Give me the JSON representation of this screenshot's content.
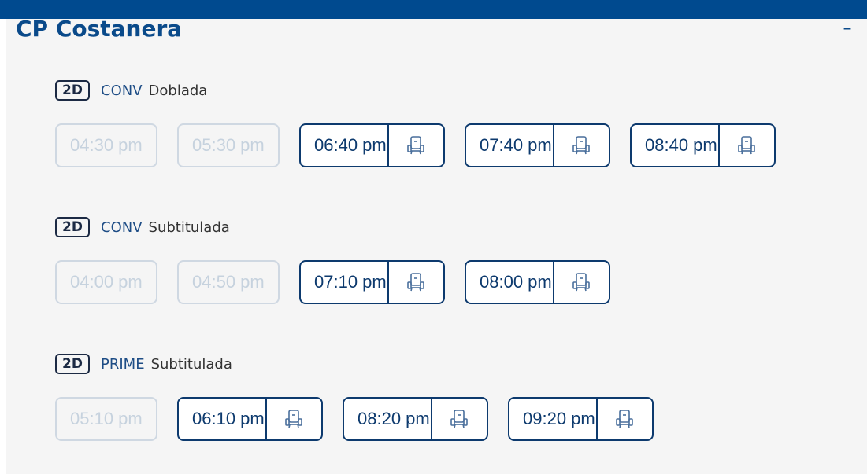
{
  "cinema": {
    "name": "CP Costanera",
    "collapse_symbol": "–"
  },
  "groups": [
    {
      "badge": "2D",
      "type": "CONV",
      "language": "Doblada",
      "times": [
        {
          "label": "04:30 pm",
          "available": false
        },
        {
          "label": "05:30 pm",
          "available": false
        },
        {
          "label": "06:40 pm",
          "available": true
        },
        {
          "label": "07:40 pm",
          "available": true
        },
        {
          "label": "08:40 pm",
          "available": true
        }
      ]
    },
    {
      "badge": "2D",
      "type": "CONV",
      "language": "Subtitulada",
      "times": [
        {
          "label": "04:00 pm",
          "available": false
        },
        {
          "label": "04:50 pm",
          "available": false
        },
        {
          "label": "07:10 pm",
          "available": true
        },
        {
          "label": "08:00 pm",
          "available": true
        }
      ]
    },
    {
      "badge": "2D",
      "type": "PRIME",
      "language": "Subtitulada",
      "times": [
        {
          "label": "05:10 pm",
          "available": false
        },
        {
          "label": "06:10 pm",
          "available": true
        },
        {
          "label": "08:20 pm",
          "available": true
        },
        {
          "label": "09:20 pm",
          "available": true
        }
      ]
    }
  ],
  "icons": {
    "seat": "seat-icon"
  },
  "colors": {
    "brand": "#004a8f",
    "accent": "#0d3a6e",
    "disabled": "#cfd8e2"
  }
}
